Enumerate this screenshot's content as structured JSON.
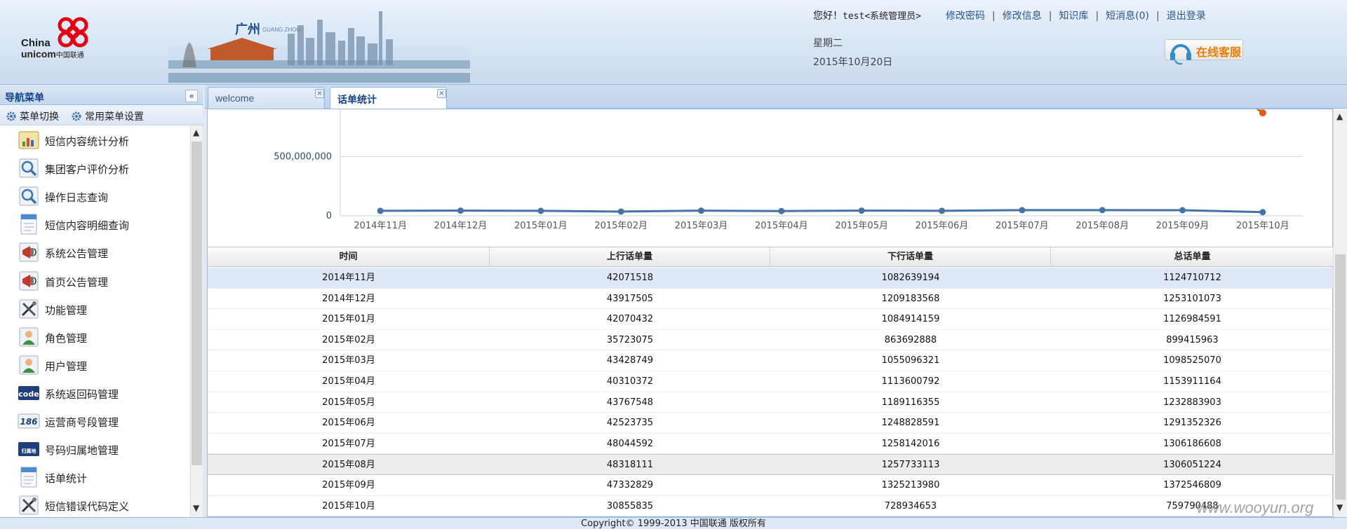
{
  "header": {
    "logo": {
      "line1": "China",
      "line2": "unicom",
      "line2_cn": "中国联通"
    },
    "city": {
      "name_cn": "广州",
      "name_en": "GUANG ZHOU"
    },
    "greeting": "您好！",
    "user": "test",
    "role": "<系统管理员>",
    "links": [
      "修改密码",
      "修改信息",
      "知识库",
      "短消息(0)",
      "退出登录"
    ],
    "weekday": "星期二",
    "date": "2015年10月20日",
    "service_label": "在线客服"
  },
  "sidebar": {
    "title": "导航菜单",
    "toolbar": {
      "switch_label": "菜单切换",
      "common_label": "常用菜单设置"
    },
    "items": [
      {
        "label": "短信内容统计分析",
        "icon": "chart-icon"
      },
      {
        "label": "集团客户评价分析",
        "icon": "magnifier-icon"
      },
      {
        "label": "操作日志查询",
        "icon": "magnifier-icon"
      },
      {
        "label": "短信内容明细查询",
        "icon": "document-icon"
      },
      {
        "label": "系统公告管理",
        "icon": "megaphone-icon"
      },
      {
        "label": "首页公告管理",
        "icon": "megaphone-icon"
      },
      {
        "label": "功能管理",
        "icon": "tools-icon"
      },
      {
        "label": "角色管理",
        "icon": "user-icon"
      },
      {
        "label": "用户管理",
        "icon": "user-icon"
      },
      {
        "label": "系统返回码管理",
        "icon": "code-icon",
        "icon_text": "code"
      },
      {
        "label": "运营商号段管理",
        "icon": "number-icon",
        "icon_text": "186"
      },
      {
        "label": "号码归属地管理",
        "icon": "location-icon",
        "icon_text": "归属地"
      },
      {
        "label": "话单统计",
        "icon": "document-icon"
      },
      {
        "label": "短信错误代码定义",
        "icon": "tools-icon"
      }
    ]
  },
  "tabs": [
    {
      "label": "welcome",
      "active": false
    },
    {
      "label": "话单统计",
      "active": true
    }
  ],
  "chart_data": {
    "type": "line",
    "categories": [
      "2014年11月",
      "2014年12月",
      "2015年01月",
      "2015年02月",
      "2015年03月",
      "2015年04月",
      "2015年05月",
      "2015年06月",
      "2015年07月",
      "2015年08月",
      "2015年09月",
      "2015年10月"
    ],
    "series": [
      {
        "values": [
          42071518,
          43917505,
          42070432,
          35723075,
          43428749,
          40310372,
          43767548,
          42523735,
          48044592,
          48318111,
          47332829,
          30855835
        ],
        "color": "#4572a7"
      }
    ],
    "y_ticks": [
      {
        "value": 0,
        "label": "0"
      },
      {
        "value": 500000000,
        "label": "500,000,000"
      }
    ],
    "ylim": [
      0,
      900000000
    ],
    "grid": true,
    "clipped_marker": {
      "value": 870000000,
      "color": "#e8580c"
    }
  },
  "grid": {
    "columns": [
      "时间",
      "上行话单量",
      "下行话单量",
      "总话单量"
    ],
    "rows": [
      [
        "2014年11月",
        "42071518",
        "1082639194",
        "1124710712"
      ],
      [
        "2014年12月",
        "43917505",
        "1209183568",
        "1253101073"
      ],
      [
        "2015年01月",
        "42070432",
        "1084914159",
        "1126984591"
      ],
      [
        "2015年02月",
        "35723075",
        "863692888",
        "899415963"
      ],
      [
        "2015年03月",
        "43428749",
        "1055096321",
        "1098525070"
      ],
      [
        "2015年04月",
        "40310372",
        "1113600792",
        "1153911164"
      ],
      [
        "2015年05月",
        "43767548",
        "1189116355",
        "1232883903"
      ],
      [
        "2015年06月",
        "42523735",
        "1248828591",
        "1291352326"
      ],
      [
        "2015年07月",
        "48044592",
        "1258142016",
        "1306186608"
      ],
      [
        "2015年08月",
        "48318111",
        "1257733113",
        "1306051224"
      ],
      [
        "2015年09月",
        "47332829",
        "1325213980",
        "1372546809"
      ],
      [
        "2015年10月",
        "30855835",
        "728934653",
        "759790488"
      ]
    ]
  },
  "footer": {
    "copyright": "Copyright© 1999-2013 中国联通  版权所有"
  },
  "watermark": "www.wooyun.org",
  "colors": {
    "accent": "#15428b",
    "line": "#4572a7",
    "highlight_row": "#dfe8f6",
    "marker_orange": "#e8580c"
  }
}
